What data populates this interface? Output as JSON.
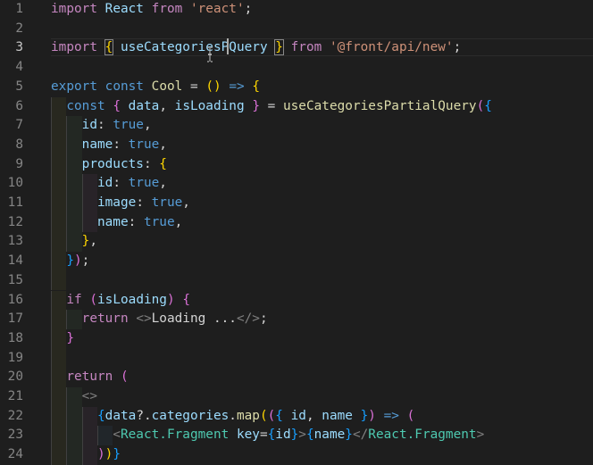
{
  "editor": {
    "active_line": 3,
    "lines": [
      {
        "n": "1",
        "tokens": [
          [
            "t-kw",
            "import"
          ],
          [
            "t-punc",
            " "
          ],
          [
            "t-var",
            "React"
          ],
          [
            "t-punc",
            " "
          ],
          [
            "t-kw",
            "from"
          ],
          [
            "t-punc",
            " "
          ],
          [
            "t-str",
            "'react'"
          ],
          [
            "t-punc",
            ";"
          ]
        ]
      },
      {
        "n": "2",
        "tokens": []
      },
      {
        "n": "3",
        "tokens": [
          [
            "t-kw",
            "import"
          ],
          [
            "t-punc",
            " "
          ],
          [
            "t-br1 bracket-match",
            "{"
          ],
          [
            "t-punc",
            " "
          ],
          [
            "t-var",
            "useCategoriesPQuery"
          ],
          [
            "t-punc",
            " "
          ],
          [
            "t-br1 bracket-match",
            "}"
          ],
          [
            "t-punc",
            " "
          ],
          [
            "t-kw",
            "from"
          ],
          [
            "t-punc",
            " "
          ],
          [
            "t-str",
            "'@front/api/new'"
          ],
          [
            "t-punc",
            ";"
          ]
        ]
      },
      {
        "n": "4",
        "tokens": []
      },
      {
        "n": "5",
        "tokens": [
          [
            "t-kw2",
            "export"
          ],
          [
            "t-punc",
            " "
          ],
          [
            "t-kw2",
            "const"
          ],
          [
            "t-punc",
            " "
          ],
          [
            "t-fn",
            "Cool"
          ],
          [
            "t-punc",
            " = "
          ],
          [
            "t-br1",
            "()"
          ],
          [
            "t-punc",
            " "
          ],
          [
            "t-kw2",
            "=>"
          ],
          [
            "t-punc",
            " "
          ],
          [
            "t-br1",
            "{"
          ]
        ]
      },
      {
        "n": "6",
        "tokens": [
          [
            "t-punc",
            "  "
          ],
          [
            "t-kw2",
            "const"
          ],
          [
            "t-punc",
            " "
          ],
          [
            "t-br2",
            "{"
          ],
          [
            "t-punc",
            " "
          ],
          [
            "t-var",
            "data"
          ],
          [
            "t-punc",
            ", "
          ],
          [
            "t-var",
            "isLoading"
          ],
          [
            "t-punc",
            " "
          ],
          [
            "t-br2",
            "}"
          ],
          [
            "t-punc",
            " = "
          ],
          [
            "t-fn",
            "useCategoriesPartialQuery"
          ],
          [
            "t-br2",
            "("
          ],
          [
            "t-br3",
            "{"
          ]
        ]
      },
      {
        "n": "7",
        "tokens": [
          [
            "t-punc",
            "    "
          ],
          [
            "t-var",
            "id"
          ],
          [
            "t-punc",
            ": "
          ],
          [
            "t-bool",
            "true"
          ],
          [
            "t-punc",
            ","
          ]
        ]
      },
      {
        "n": "8",
        "tokens": [
          [
            "t-punc",
            "    "
          ],
          [
            "t-var",
            "name"
          ],
          [
            "t-punc",
            ": "
          ],
          [
            "t-bool",
            "true"
          ],
          [
            "t-punc",
            ","
          ]
        ]
      },
      {
        "n": "9",
        "tokens": [
          [
            "t-punc",
            "    "
          ],
          [
            "t-var",
            "products"
          ],
          [
            "t-punc",
            ": "
          ],
          [
            "t-br1",
            "{"
          ]
        ]
      },
      {
        "n": "10",
        "tokens": [
          [
            "t-punc",
            "      "
          ],
          [
            "t-var",
            "id"
          ],
          [
            "t-punc",
            ": "
          ],
          [
            "t-bool",
            "true"
          ],
          [
            "t-punc",
            ","
          ]
        ]
      },
      {
        "n": "11",
        "tokens": [
          [
            "t-punc",
            "      "
          ],
          [
            "t-var",
            "image"
          ],
          [
            "t-punc",
            ": "
          ],
          [
            "t-bool",
            "true"
          ],
          [
            "t-punc",
            ","
          ]
        ]
      },
      {
        "n": "12",
        "tokens": [
          [
            "t-punc",
            "      "
          ],
          [
            "t-var",
            "name"
          ],
          [
            "t-punc",
            ": "
          ],
          [
            "t-bool",
            "true"
          ],
          [
            "t-punc",
            ","
          ]
        ]
      },
      {
        "n": "13",
        "tokens": [
          [
            "t-punc",
            "    "
          ],
          [
            "t-br1",
            "}"
          ],
          [
            "t-punc",
            ","
          ]
        ]
      },
      {
        "n": "14",
        "tokens": [
          [
            "t-punc",
            "  "
          ],
          [
            "t-br3",
            "}"
          ],
          [
            "t-br2",
            ")"
          ],
          [
            "t-punc",
            ";"
          ]
        ]
      },
      {
        "n": "15",
        "tokens": []
      },
      {
        "n": "16",
        "tokens": [
          [
            "t-punc",
            "  "
          ],
          [
            "t-kw",
            "if"
          ],
          [
            "t-punc",
            " "
          ],
          [
            "t-br2",
            "("
          ],
          [
            "t-var",
            "isLoading"
          ],
          [
            "t-br2",
            ")"
          ],
          [
            "t-punc",
            " "
          ],
          [
            "t-br2",
            "{"
          ]
        ]
      },
      {
        "n": "17",
        "tokens": [
          [
            "t-punc",
            "    "
          ],
          [
            "t-kw",
            "return"
          ],
          [
            "t-punc",
            " "
          ],
          [
            "t-tag",
            "<>"
          ],
          [
            "t-punc",
            "Loading ..."
          ],
          [
            "t-tag",
            "</>"
          ],
          [
            "t-punc",
            ";"
          ]
        ]
      },
      {
        "n": "18",
        "tokens": [
          [
            "t-punc",
            "  "
          ],
          [
            "t-br2",
            "}"
          ]
        ]
      },
      {
        "n": "19",
        "tokens": []
      },
      {
        "n": "20",
        "tokens": [
          [
            "t-punc",
            "  "
          ],
          [
            "t-kw",
            "return"
          ],
          [
            "t-punc",
            " "
          ],
          [
            "t-br2",
            "("
          ]
        ]
      },
      {
        "n": "21",
        "tokens": [
          [
            "t-punc",
            "    "
          ],
          [
            "t-tag",
            "<>"
          ]
        ]
      },
      {
        "n": "22",
        "tokens": [
          [
            "t-punc",
            "      "
          ],
          [
            "t-br3",
            "{"
          ],
          [
            "t-var",
            "data"
          ],
          [
            "t-punc",
            "?."
          ],
          [
            "t-var",
            "categories"
          ],
          [
            "t-punc",
            "."
          ],
          [
            "t-fn",
            "map"
          ],
          [
            "t-br1",
            "("
          ],
          [
            "t-br2",
            "("
          ],
          [
            "t-br3",
            "{"
          ],
          [
            "t-punc",
            " "
          ],
          [
            "t-var",
            "id"
          ],
          [
            "t-punc",
            ", "
          ],
          [
            "t-var",
            "name"
          ],
          [
            "t-punc",
            " "
          ],
          [
            "t-br3",
            "}"
          ],
          [
            "t-br2",
            ")"
          ],
          [
            "t-punc",
            " "
          ],
          [
            "t-kw2",
            "=>"
          ],
          [
            "t-punc",
            " "
          ],
          [
            "t-br2",
            "("
          ]
        ]
      },
      {
        "n": "23",
        "tokens": [
          [
            "t-punc",
            "        "
          ],
          [
            "t-tag",
            "<"
          ],
          [
            "t-comp",
            "React.Fragment"
          ],
          [
            "t-punc",
            " "
          ],
          [
            "t-attr",
            "key"
          ],
          [
            "t-punc",
            "="
          ],
          [
            "t-br3",
            "{"
          ],
          [
            "t-var",
            "id"
          ],
          [
            "t-br3",
            "}"
          ],
          [
            "t-tag",
            ">"
          ],
          [
            "t-br3",
            "{"
          ],
          [
            "t-var",
            "name"
          ],
          [
            "t-br3",
            "}"
          ],
          [
            "t-tag",
            "</"
          ],
          [
            "t-comp",
            "React.Fragment"
          ],
          [
            "t-tag",
            ">"
          ]
        ]
      },
      {
        "n": "24",
        "tokens": [
          [
            "t-punc",
            "      "
          ],
          [
            "t-br2",
            ")"
          ],
          [
            "t-br1",
            ")"
          ],
          [
            "t-br3",
            "}"
          ]
        ]
      }
    ]
  }
}
